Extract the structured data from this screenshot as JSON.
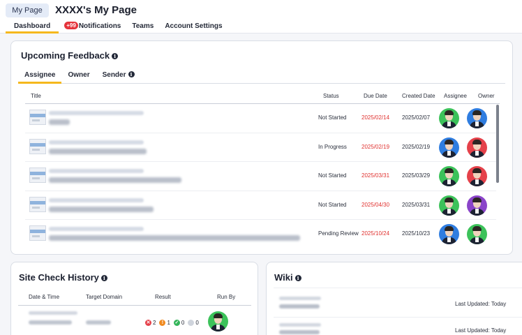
{
  "header": {
    "mypage_button": "My Page",
    "title": "XXXX's My Page",
    "nav": [
      {
        "label": "Dashboard",
        "active": true
      },
      {
        "label": "Notifications",
        "badge": "+99"
      },
      {
        "label": "Teams"
      },
      {
        "label": "Account Settings"
      }
    ]
  },
  "feedback": {
    "title": "Upcoming Feedback",
    "tabs": [
      {
        "label": "Assignee",
        "active": true
      },
      {
        "label": "Owner"
      },
      {
        "label": "Sender",
        "info": true
      }
    ],
    "columns": {
      "title": "Title",
      "status": "Status",
      "due": "Due Date",
      "created": "Created Date",
      "assignee": "Assignee",
      "owner": "Owner"
    },
    "rows": [
      {
        "status": "Not Started",
        "due": "2025/02/14",
        "created": "2025/02/07",
        "assignee_bg": "#3cc25a",
        "owner_bg": "#2f7de0"
      },
      {
        "status": "In Progress",
        "due": "2025/02/19",
        "created": "2025/02/19",
        "assignee_bg": "#2f7de0",
        "owner_bg": "#e5414a"
      },
      {
        "status": "Not Started",
        "due": "2025/03/31",
        "created": "2025/03/29",
        "assignee_bg": "#3cc25a",
        "owner_bg": "#e5414a"
      },
      {
        "status": "Not Started",
        "due": "2025/04/30",
        "created": "2025/03/31",
        "assignee_bg": "#3cc25a",
        "owner_bg": "#8a44c9"
      },
      {
        "status": "Pending Review",
        "due": "2025/10/24",
        "created": "2025/10/23",
        "assignee_bg": "#2f7de0",
        "owner_bg": "#3cc25a"
      }
    ]
  },
  "site_check": {
    "title": "Site Check History",
    "columns": {
      "datetime": "Date & Time",
      "domain": "Target Domain",
      "result": "Result",
      "runby": "Run By"
    },
    "row": {
      "result": {
        "error": "2",
        "warning": "1",
        "ok": "0",
        "skipped": "0"
      },
      "runby_bg": "#3cc25a"
    }
  },
  "wiki": {
    "title": "Wiki",
    "items": [
      {
        "updated": "Last Updated: Today"
      },
      {
        "updated": "Last Updated: Today"
      }
    ]
  },
  "colors": {
    "accent": "#f5b81c",
    "due_date": "#e0312f",
    "badge": "#e5333b"
  }
}
